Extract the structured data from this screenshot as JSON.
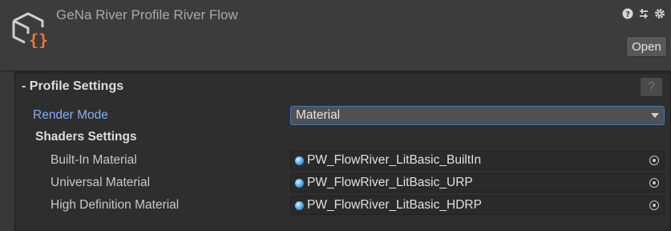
{
  "header": {
    "title": "GeNa River Profile River Flow",
    "open_label": "Open",
    "icons": [
      "help-icon",
      "preset-icon",
      "settings-icon"
    ]
  },
  "panel": {
    "title": "- Profile Settings",
    "help_label": "?",
    "render_mode": {
      "label": "Render Mode",
      "value": "Material"
    },
    "shaders": {
      "title": "Shaders Settings",
      "fields": [
        {
          "label": "Built-In Material",
          "value": "PW_FlowRiver_LitBasic_BuiltIn"
        },
        {
          "label": "Universal Material",
          "value": "PW_FlowRiver_LitBasic_URP"
        },
        {
          "label": "High Definition Material",
          "value": "PW_FlowRiver_LitBasic_HDRP"
        }
      ]
    }
  },
  "colors": {
    "background": "#383838",
    "panel": "#2e2e2e",
    "accent_blue": "#7fb0f3",
    "icon_orange": "#f0743c"
  }
}
